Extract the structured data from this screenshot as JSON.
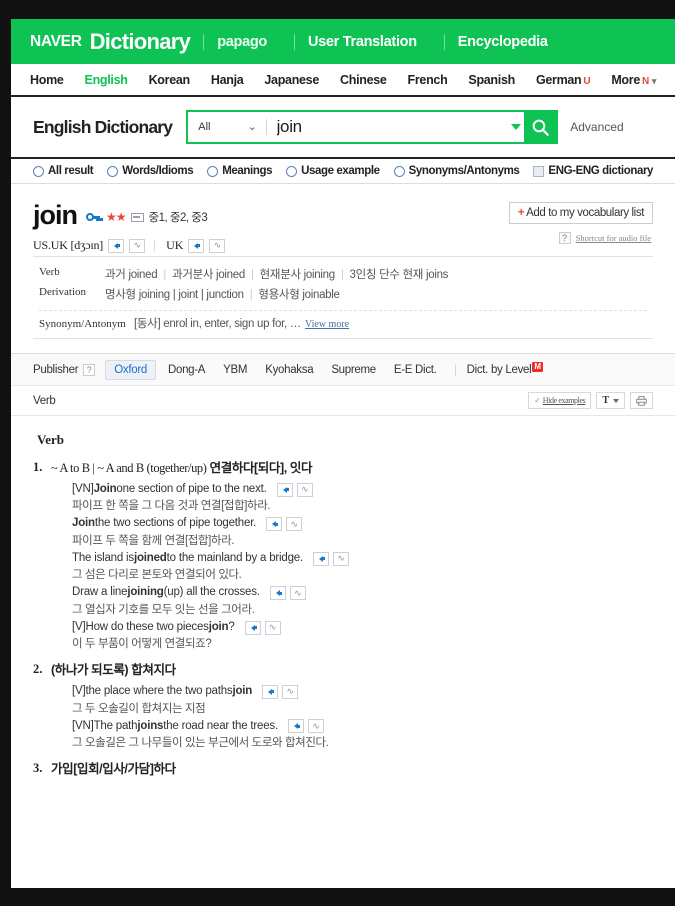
{
  "gnb": {
    "logo_naver": "NAVER",
    "logo_dictionary": "Dictionary",
    "links": [
      "papago",
      "User Translation",
      "Encyclopedia"
    ]
  },
  "lnb": {
    "items": [
      {
        "label": "Home",
        "active": false,
        "sup": ""
      },
      {
        "label": "English",
        "active": true,
        "sup": ""
      },
      {
        "label": "Korean",
        "active": false,
        "sup": ""
      },
      {
        "label": "Hanja",
        "active": false,
        "sup": ""
      },
      {
        "label": "Japanese",
        "active": false,
        "sup": ""
      },
      {
        "label": "Chinese",
        "active": false,
        "sup": ""
      },
      {
        "label": "French",
        "active": false,
        "sup": ""
      },
      {
        "label": "Spanish",
        "active": false,
        "sup": ""
      },
      {
        "label": "German",
        "active": false,
        "sup": "U"
      },
      {
        "label": "More",
        "active": false,
        "sup": "N"
      }
    ]
  },
  "search": {
    "dict_title": "English Dictionary",
    "scope_selected": "All",
    "query": "join",
    "placeholder": "",
    "search_icon": "search-icon",
    "advanced_label": "Advanced"
  },
  "filters": {
    "radios": [
      "All result",
      "Words/Idioms",
      "Meanings",
      "Usage example",
      "Synonyms/Antonyms"
    ],
    "checkbox_label": "ENG-ENG dictionary"
  },
  "entry": {
    "headword": "join",
    "stars": "★★",
    "levels": "중1, 중2, 중3",
    "pron_us_uk_label": "US.UK",
    "pron_ipa": "[dʒɔɪn]",
    "pron_uk_label": "UK",
    "vocab_button": "Add to my vocabulary list",
    "vocab_plus": "+",
    "help_mark": "?",
    "shortcut_text": "Shortcut for audio file",
    "info": [
      {
        "key": "Verb",
        "parts": [
          "과거 joined",
          "과거분사 joined",
          "현재분사 joining",
          "3인칭 단수 현재 joins"
        ]
      },
      {
        "key": "Derivation",
        "parts": [
          "명사형 joining | joint | junction",
          "형용사형 joinable"
        ]
      }
    ],
    "synonym": {
      "key": "Synonym/Antonym",
      "value": "[동사] enrol in, enter, sign up for, …",
      "view_more": "View more"
    }
  },
  "publisher": {
    "label": "Publisher",
    "help": "?",
    "items": [
      "Oxford",
      "Dong-A",
      "YBM",
      "Kyohaksa",
      "Supreme",
      "E-E Dict."
    ],
    "active": "Oxford",
    "by_level_label": "Dict. by Level",
    "by_level_badge": "M"
  },
  "toolbar": {
    "pos_label": "Verb",
    "hide_examples": "Hide examples",
    "check_mark": "✓",
    "font_label": "T",
    "print_icon": "print-icon"
  },
  "content": {
    "pos_heading": "Verb",
    "senses": [
      {
        "num": "1.",
        "pattern": "~ A to B | ~ A and B (together/up)",
        "korean": "연결하다[되다], 잇다",
        "examples": [
          {
            "tag": "[VN] ",
            "en_pre": "",
            "en_bold": "Join",
            "en_post": " one section of pipe to the next.",
            "kr": "파이프 한 쪽을 그 다음 것과 연결[접합]하라."
          },
          {
            "tag": "",
            "en_pre": "",
            "en_bold": "Join",
            "en_post": " the two sections of pipe together.",
            "kr": "파이프 두 쪽을 함께 연결[접합]하라."
          },
          {
            "tag": "",
            "en_pre": "The island is ",
            "en_bold": "joined",
            "en_post": " to the mainland by a bridge.",
            "kr": "그 섬은 다리로 본토와 연결되어 있다."
          },
          {
            "tag": "",
            "en_pre": "Draw a line ",
            "en_bold": "joining",
            "en_post": " (up) all the crosses.",
            "kr": "그 열십자 기호를 모두 잇는 선을 그어라."
          },
          {
            "tag": "[V] ",
            "en_pre": "How do these two pieces ",
            "en_bold": "join",
            "en_post": "?",
            "kr": "이 두 부품이 어떻게 연결되죠?"
          }
        ]
      },
      {
        "num": "2.",
        "pattern": "",
        "korean": "(하나가 되도록) 합쳐지다",
        "examples": [
          {
            "tag": "[V] ",
            "en_pre": "the place where the two paths ",
            "en_bold": "join",
            "en_post": "",
            "kr": "그 두 오솔길이 합쳐지는 지점"
          },
          {
            "tag": "[VN] ",
            "en_pre": "The path ",
            "en_bold": "joins",
            "en_post": " the road near the trees.",
            "kr": "그 오솔길은 그 나무들이 있는 부근에서 도로와 합쳐진다."
          }
        ]
      },
      {
        "num": "3.",
        "pattern": "",
        "korean": "가입[입회/입사/가담]하다",
        "examples": []
      }
    ]
  },
  "colors": {
    "naver_green": "#0ec254",
    "accent_red": "#e8453c",
    "link_blue": "#1a6fd4",
    "badge_red": "#ef2b2b"
  }
}
